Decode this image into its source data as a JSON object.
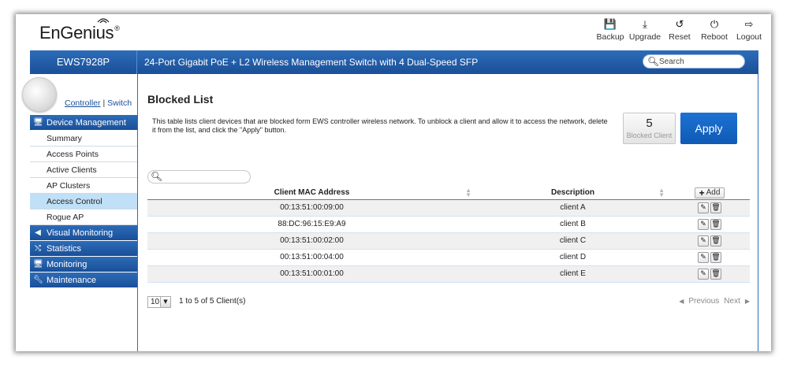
{
  "brand": {
    "logo_text": "EnGenius",
    "reg_mark": "®"
  },
  "header_actions": [
    {
      "label": "Backup",
      "icon": "floppy-icon",
      "glyph": "💾"
    },
    {
      "label": "Upgrade",
      "icon": "download-icon",
      "glyph": "⤓"
    },
    {
      "label": "Reset",
      "icon": "refresh-icon",
      "glyph": "↺"
    },
    {
      "label": "Reboot",
      "icon": "power-icon",
      "glyph": "⏻"
    },
    {
      "label": "Logout",
      "icon": "logout-icon",
      "glyph": "⇨"
    }
  ],
  "model_bar": {
    "model": "EWS7928P",
    "description": "24-Port Gigabit PoE + L2 Wireless Management Switch with 4 Dual-Speed SFP",
    "search_placeholder": "Search"
  },
  "sidebar": {
    "controller_label": "Controller",
    "separator": "|",
    "switch_label": "Switch",
    "sections": [
      {
        "label": "Device Management",
        "icon": "device-icon",
        "items": [
          "Summary",
          "Access Points",
          "Active Clients",
          "AP Clusters",
          "Access Control",
          "Rogue AP"
        ],
        "active_item": "Access Control"
      },
      {
        "label": "Visual Monitoring",
        "icon": "share-icon"
      },
      {
        "label": "Statistics",
        "icon": "shuffle-icon"
      },
      {
        "label": "Monitoring",
        "icon": "monitor-icon"
      },
      {
        "label": "Maintenance",
        "icon": "wrench-icon"
      }
    ]
  },
  "main": {
    "title": "Blocked List",
    "intro": "This table lists client devices that are blocked form EWS controller wireless network. To unblock a client and allow it to access the network, delete it from the list, and click the \"Apply\" button.",
    "blocked_count": "5",
    "blocked_caption": "Blocked Client",
    "apply_label": "Apply",
    "table": {
      "columns": [
        "Client MAC Address",
        "Description"
      ],
      "add_label": "Add",
      "rows": [
        {
          "mac": "00:13:51:00:09:00",
          "description": "client A"
        },
        {
          "mac": "88:DC:96:15:E9:A9",
          "description": "client B"
        },
        {
          "mac": "00:13:51:00:02:00",
          "description": "client C"
        },
        {
          "mac": "00:13:51:00:04:00",
          "description": "client D"
        },
        {
          "mac": "00:13:51:00:01:00",
          "description": "client E"
        }
      ]
    },
    "pagination": {
      "per_page": "10",
      "range_text": "1 to 5 of 5 Client(s)",
      "previous": "Previous",
      "next": "Next"
    }
  },
  "colors": {
    "brand_blue": "#1a4f98",
    "apply_blue": "#0e5ab5",
    "active_nav": "#bfe0f7"
  }
}
